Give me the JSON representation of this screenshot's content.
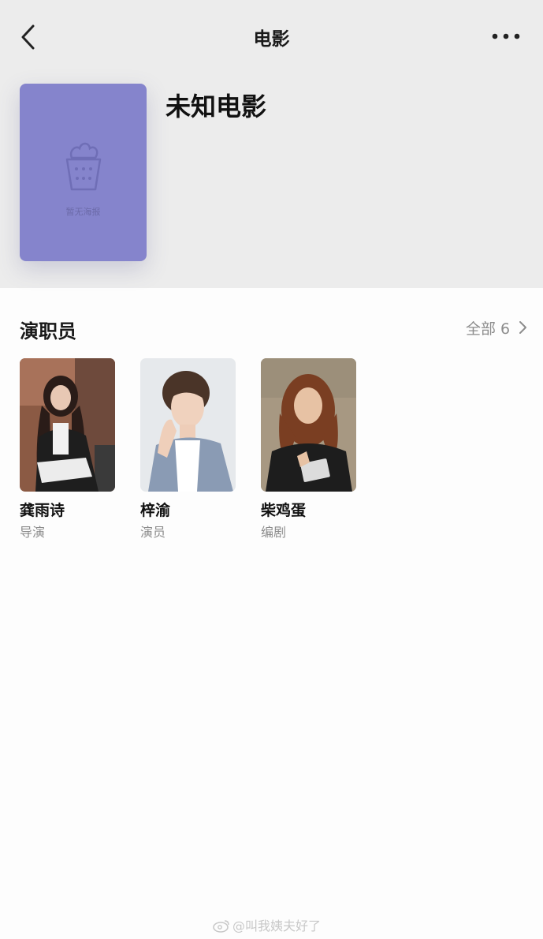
{
  "nav": {
    "title": "电影",
    "back_icon": "back-chevron-icon",
    "more_icon": "more-dots-icon"
  },
  "movie": {
    "title": "未知电影",
    "poster_placeholder_text": "暂无海报",
    "poster_color": "#8584cc"
  },
  "cast_section": {
    "title": "演职员",
    "see_all_label": "全部 6",
    "members": [
      {
        "name": "龚雨诗",
        "role": "导演"
      },
      {
        "name": "梓渝",
        "role": "演员"
      },
      {
        "name": "柴鸡蛋",
        "role": "编剧"
      }
    ]
  },
  "watermark": {
    "text": "@叫我姨夫好了"
  }
}
